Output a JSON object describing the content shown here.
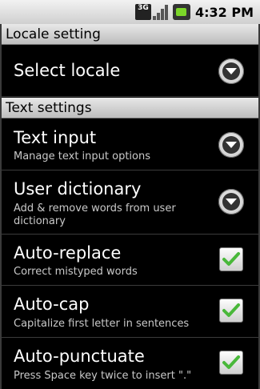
{
  "status_bar": {
    "network": "3G",
    "time": "4:32 PM"
  },
  "sections": {
    "locale": {
      "header": "Locale setting",
      "select_locale": "Select locale"
    },
    "text": {
      "header": "Text settings",
      "text_input": {
        "title": "Text input",
        "subtitle": "Manage text input options"
      },
      "user_dictionary": {
        "title": "User dictionary",
        "subtitle": "Add & remove words from user dictionary"
      },
      "auto_replace": {
        "title": "Auto-replace",
        "subtitle": "Correct mistyped words",
        "checked": true
      },
      "auto_cap": {
        "title": "Auto-cap",
        "subtitle": "Capitalize first letter in sentences",
        "checked": true
      },
      "auto_punctuate": {
        "title": "Auto-punctuate",
        "subtitle": "Press Space key twice to insert \".\"",
        "checked": true
      }
    }
  },
  "icons": {
    "dropdown": "circle-chevron-down-icon",
    "checkbox": "green-checkmark-icon"
  },
  "colors": {
    "checkmark": "#49b83a",
    "header_bg": "#d6d6d6"
  }
}
